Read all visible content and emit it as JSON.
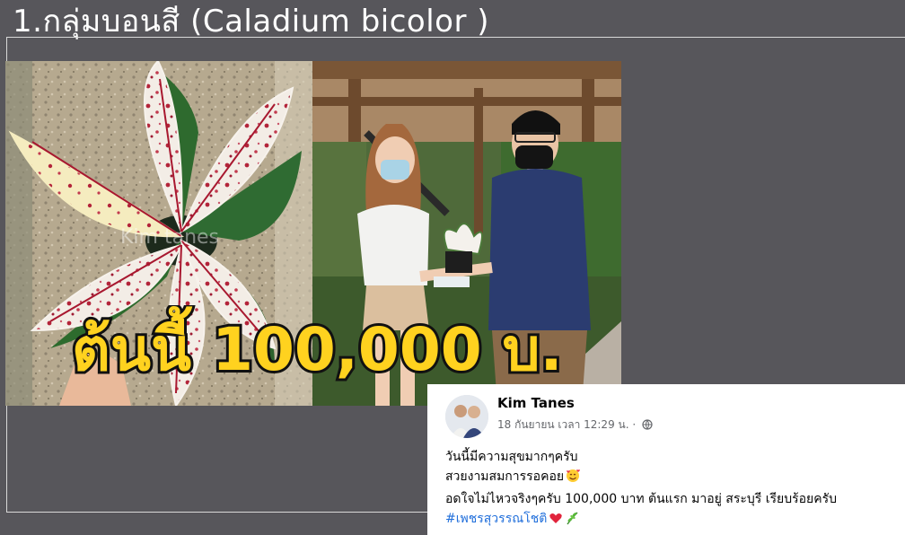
{
  "slide": {
    "title": "1.กลุ่มบอนสี (Caladium bicolor )"
  },
  "photo_plant": {
    "watermark": "Kim tanes",
    "price_overlay": "ต้นนี้ 100,000 บ.",
    "overlay_fill": "#ffd21f",
    "overlay_stroke": "#111111"
  },
  "post": {
    "author": "Kim Tanes",
    "meta": "18 กันยายน เวลา 12:29 น. ·",
    "privacy_icon": "globe-icon",
    "lines": [
      "วันนี้มีความสุขมากๆครับ",
      "สวยงามสมการรอคอย",
      "อดใจไม่ไหวจริงๆครับ 100,000 บาท ต้นแรก มาอยู่ สระบุรี เรียบร้อยครับ"
    ],
    "hashtag": "#เพชรสุวรรณโชติ",
    "emojis": [
      "smiling-face-with-hearts",
      "red-heart",
      "herb"
    ],
    "link_color": "#216fdb"
  }
}
